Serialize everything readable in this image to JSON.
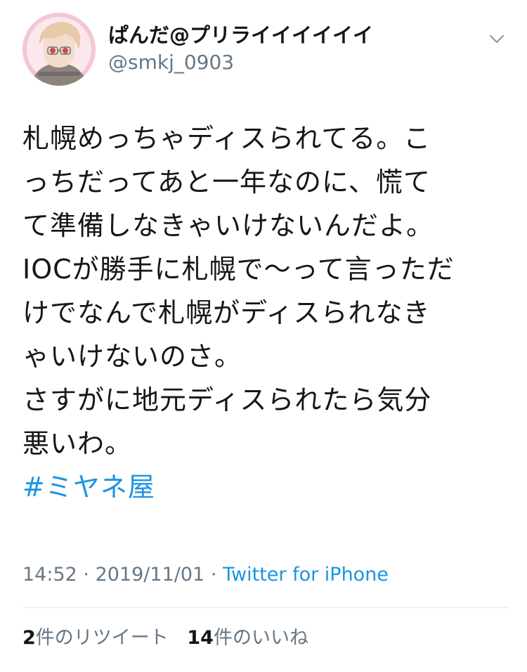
{
  "tweet": {
    "author": {
      "display_name": "ぱんだ@プリライイイイイイ",
      "handle": "@smkj_0903"
    },
    "menu_icon": "chevron-down-icon",
    "text_lines": [
      "札幌めっちゃディスられてる。こ",
      "っちだってあと一年なのに、慌て",
      "て準備しなきゃいけないんだよ。",
      "IOCが勝手に札幌で〜って言っただ",
      "けでなんで札幌がディスられなき",
      "ゃいけないのさ。",
      "さすがに地元ディスられたら気分",
      "悪いわ。"
    ],
    "hashtag": "#ミヤネ屋",
    "time": "14:52",
    "date": "2019/11/01",
    "separator": "·",
    "source": "Twitter for iPhone",
    "stats": {
      "retweets_count": "2",
      "retweets_label": "件のリツイート",
      "likes_count": "14",
      "likes_label": "件のいいね"
    }
  },
  "colors": {
    "link": "#1b95e0",
    "secondary_text": "#657786",
    "primary_text": "#14171a",
    "divider": "#e1e8ed"
  }
}
